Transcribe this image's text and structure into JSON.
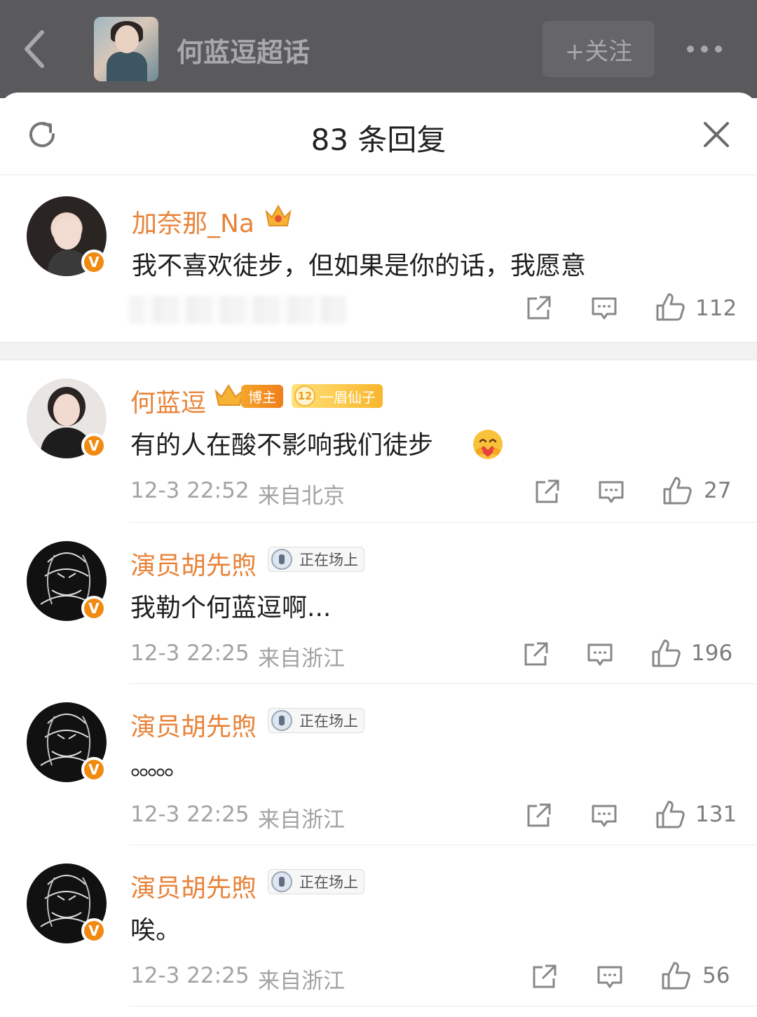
{
  "topbar": {
    "back_icon": "chevron-left-icon",
    "topic_title": "何蓝逗超话",
    "follow_label": "+关注",
    "more_icon": "more-dots-icon"
  },
  "sheet": {
    "title": "83 条回复",
    "refresh_icon": "refresh-icon",
    "close_icon": "close-icon"
  },
  "root_comment": {
    "username": "加奈那_Na",
    "crown_icon": "crown-icon",
    "verified_badge": "V",
    "text": "我不喜欢徒步，但如果是你的话，我愿意",
    "likes": "112"
  },
  "replies": [
    {
      "username": "何蓝逗",
      "badges": {
        "blogger": "博主",
        "fan_level": "12",
        "fan_title": "一眉仙子"
      },
      "text": "有的人在酸不影响我们徒步",
      "emoji_icon": "hug-emoji-icon",
      "time": "12-3 22:52",
      "location": "来自北京",
      "likes": "27"
    },
    {
      "username": "演员胡先煦",
      "badge": "正在场上",
      "text": "我勒个何蓝逗啊...",
      "time": "12-3 22:25",
      "location": "来自浙江",
      "likes": "196"
    },
    {
      "username": "演员胡先煦",
      "badge": "正在场上",
      "text": "。。。。。",
      "time": "12-3 22:25",
      "location": "来自浙江",
      "likes": "131"
    },
    {
      "username": "演员胡先煦",
      "badge": "正在场上",
      "text": "唉。",
      "time": "12-3 22:25",
      "location": "来自浙江",
      "likes": "56"
    }
  ],
  "colors": {
    "username": "#e8843a",
    "verified": "#f08a10",
    "meta": "#a3a3a3",
    "dimmed_bar": "#5a5a5c"
  }
}
